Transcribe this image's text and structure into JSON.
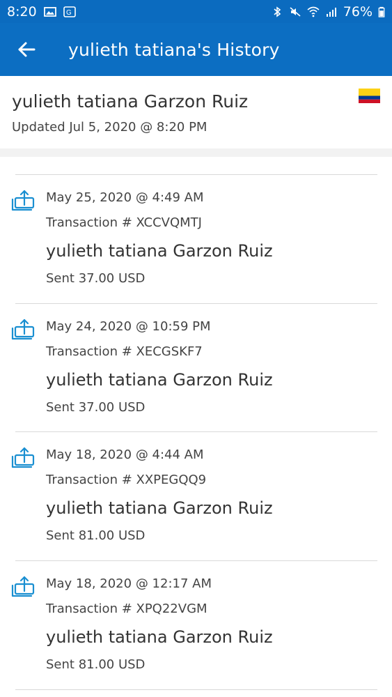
{
  "status_bar": {
    "time": "8:20",
    "battery": "76%",
    "icons": [
      "gallery-icon",
      "translate-icon",
      "bluetooth-icon",
      "mute-icon",
      "wifi-icon",
      "signal-icon",
      "battery-icon"
    ]
  },
  "app_bar": {
    "title": "yulieth tatiana's History",
    "back_icon": "arrow-left-icon"
  },
  "profile": {
    "name": "yulieth tatiana Garzon Ruiz",
    "updated": "Updated Jul 5, 2020 @ 8:20 PM",
    "flag_colors": [
      "#fcd116",
      "#003893",
      "#ce1126"
    ]
  },
  "colors": {
    "primary": "#0c6ec2",
    "icon": "#1a8fd1"
  },
  "transactions": [
    {
      "date": "May 25, 2020 @ 4:49 AM",
      "id": "Transaction # XCCVQMTJ",
      "recipient": "yulieth tatiana Garzon Ruiz",
      "amount": "Sent 37.00 USD"
    },
    {
      "date": "May 24, 2020 @ 10:59 PM",
      "id": "Transaction # XECGSKF7",
      "recipient": "yulieth tatiana Garzon Ruiz",
      "amount": "Sent 37.00 USD"
    },
    {
      "date": "May 18, 2020 @ 4:44 AM",
      "id": "Transaction # XXPEGQQ9",
      "recipient": "yulieth tatiana Garzon Ruiz",
      "amount": "Sent 81.00 USD"
    },
    {
      "date": "May 18, 2020 @ 12:17 AM",
      "id": "Transaction # XPQ22VGM",
      "recipient": "yulieth tatiana Garzon Ruiz",
      "amount": "Sent 81.00 USD"
    }
  ]
}
